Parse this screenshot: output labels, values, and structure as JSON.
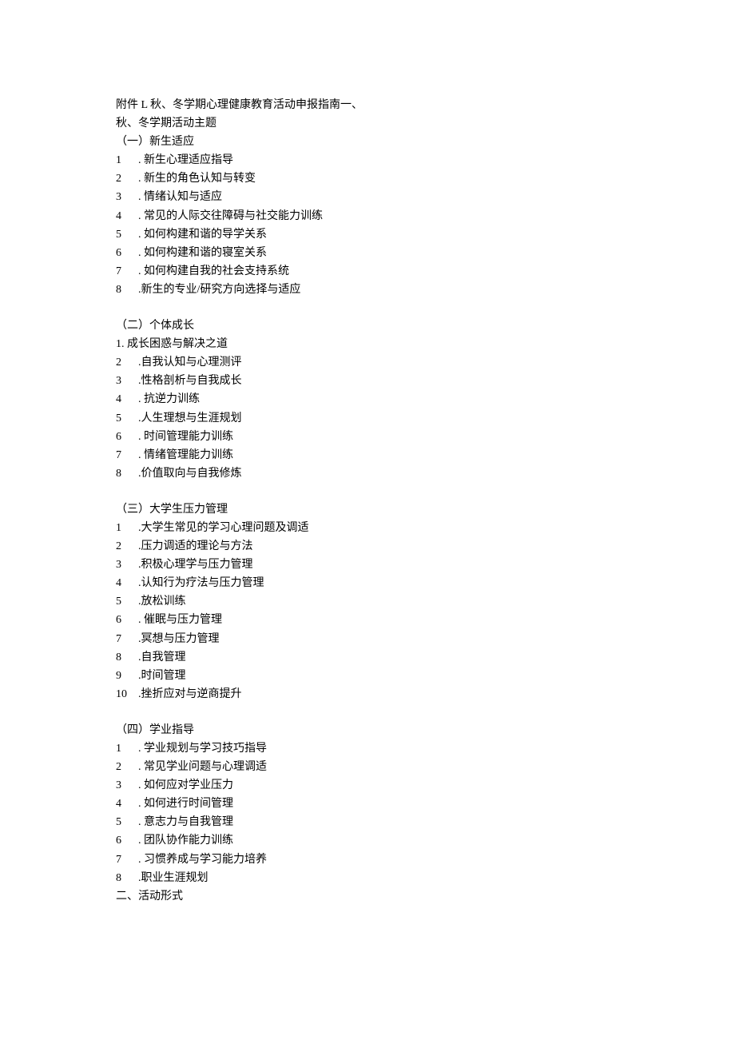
{
  "header1": "附件 L 秋、冬学期心理健康教育活动申报指南一、",
  "header2": "秋、冬学期活动主题",
  "section1": {
    "title": "（一）新生适应",
    "items": [
      {
        "num": "1",
        "text": ". 新生心理适应指导"
      },
      {
        "num": "2",
        "text": ". 新生的角色认知与转变"
      },
      {
        "num": "3",
        "text": ". 情绪认知与适应"
      },
      {
        "num": "4",
        "text": ". 常见的人际交往障碍与社交能力训练"
      },
      {
        "num": "5",
        "text": ". 如何构建和谐的导学关系"
      },
      {
        "num": "6",
        "text": ". 如何构建和谐的寝室关系"
      },
      {
        "num": "7",
        "text": ". 如何构建自我的社会支持系统"
      },
      {
        "num": "8",
        "text": ".新生的专业/研究方向选择与适应"
      }
    ]
  },
  "section2": {
    "title": "（二）个体成长",
    "first": "1. 成长困惑与解决之道",
    "items": [
      {
        "num": "2",
        "text": ".自我认知与心理测评"
      },
      {
        "num": "3",
        "text": ".性格剖析与自我成长"
      },
      {
        "num": "4",
        "text": ". 抗逆力训练"
      },
      {
        "num": "5",
        "text": ".人生理想与生涯规划"
      },
      {
        "num": "6",
        "text": ". 时间管理能力训练"
      },
      {
        "num": "7",
        "text": ". 情绪管理能力训练"
      },
      {
        "num": "8",
        "text": ".价值取向与自我修炼"
      }
    ]
  },
  "section3": {
    "title": "（三）大学生压力管理",
    "items": [
      {
        "num": "1",
        "text": ".大学生常见的学习心理问题及调适"
      },
      {
        "num": "2",
        "text": ".压力调适的理论与方法"
      },
      {
        "num": "3",
        "text": ".积极心理学与压力管理"
      },
      {
        "num": "4",
        "text": ".认知行为疗法与压力管理"
      },
      {
        "num": "5",
        "text": ".放松训练"
      },
      {
        "num": "6",
        "text": ". 催眠与压力管理"
      },
      {
        "num": "7",
        "text": ".冥想与压力管理"
      },
      {
        "num": "8",
        "text": ".自我管理"
      },
      {
        "num": "9",
        "text": ".时间管理"
      },
      {
        "num": "10",
        "text": ".挫折应对与逆商提升"
      }
    ]
  },
  "section4": {
    "title": "（四）学业指导",
    "items": [
      {
        "num": "1",
        "text": ". 学业规划与学习技巧指导"
      },
      {
        "num": "2",
        "text": ". 常见学业问题与心理调适"
      },
      {
        "num": "3",
        "text": ". 如何应对学业压力"
      },
      {
        "num": "4",
        "text": ". 如何进行时间管理"
      },
      {
        "num": "5",
        "text": ". 意志力与自我管理"
      },
      {
        "num": "6",
        "text": ". 团队协作能力训练"
      },
      {
        "num": "7",
        "text": ". 习惯养成与学习能力培养"
      },
      {
        "num": "8",
        "text": ".职业生涯规划"
      }
    ]
  },
  "footer": "二、活动形式"
}
